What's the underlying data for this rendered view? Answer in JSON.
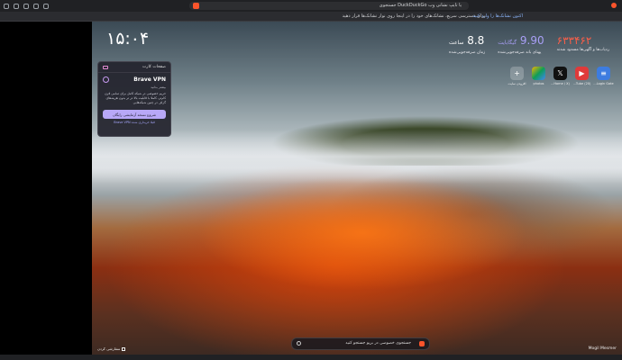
{
  "browser": {
    "address_text": "جستجوی DuckDuckGo یا تایپ نشانی وب",
    "infobar_text": "برای دسترسی سریع، نشانک‌های خود را در اینجا روی نوار نشانک‌ها قرار دهید.",
    "infobar_link": "اکنون نشانک‌ها را وارد کنید"
  },
  "ntp": {
    "clock": "۱۵:۰۴",
    "stats": [
      {
        "value": "۶۳۳۴۶۲",
        "unit": "",
        "label": "ردیاب‌ها و آگهی‌ها مسدود شدند",
        "color": "#fb5f49"
      },
      {
        "value": "9.90",
        "unit": "گیگابایت",
        "label": "پهنای باند صرفه‌جویی‌شده",
        "color": "#a99ff6"
      },
      {
        "value": "8.8",
        "unit": "ساعت",
        "label": "زمان صرفه‌جویی‌شده",
        "color": "#ffffff"
      }
    ],
    "top_sites": [
      {
        "label": "Login Gate...",
        "icon": "doc-icon"
      },
      {
        "label": "(Tube (20...",
        "icon": "youtube-icon"
      },
      {
        "label": "(Home / X...",
        "icon": "x-icon"
      },
      {
        "label": "photos",
        "icon": "photos-icon"
      },
      {
        "label": "افزودن سایت",
        "icon": "plus-icon"
      }
    ],
    "search_placeholder": "جستجوی خصوصی در بریو جستجو کنید",
    "photo_credit": "Mogil Mesmer",
    "customize_label": "سفارشی کردن"
  },
  "vpn_card": {
    "header": "صفحات کارت",
    "title": "Brave VPN",
    "subtitle": "بیشتر بدانید",
    "description": "حریم خصوصی در شبکه کامل برای تمامی قرن کام‌تر، کاملا با قابلیت بالا در تر بدون هزینه‌های گزاف در چنین شبکه‌هایی",
    "button": "شروع نسخه آزمایشی رایگان",
    "link": "Brave VPN قبلا خریداری شده"
  }
}
